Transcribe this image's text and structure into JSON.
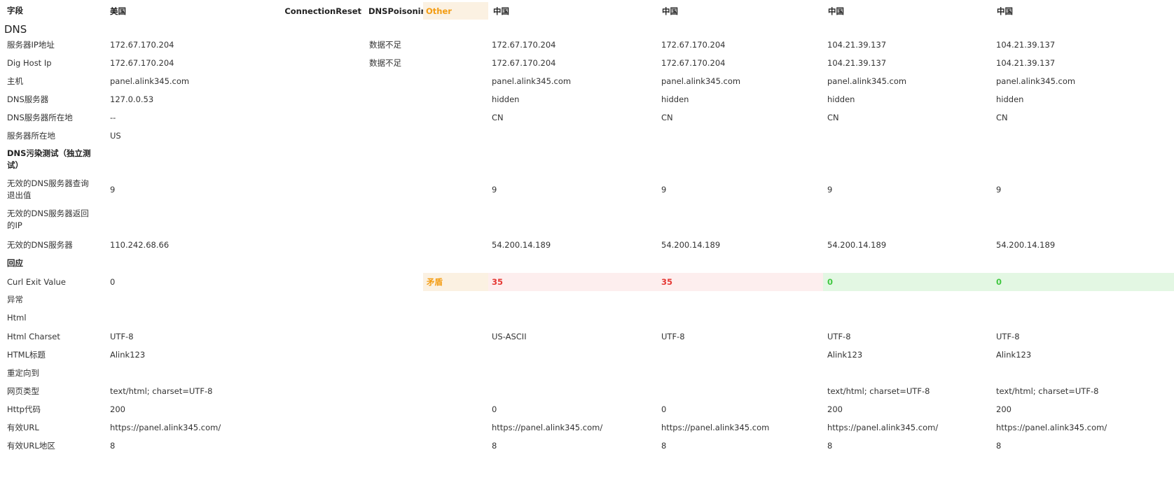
{
  "header": {
    "field": "字段",
    "col1": "美国",
    "col2": "ConnectionReset",
    "col3": "DNSPoisoning",
    "col4": "Other",
    "col5": "中国",
    "col6": "中国",
    "col7": "中国",
    "col8": "中国"
  },
  "section_dns": "DNS",
  "rows": {
    "server_ip": {
      "label": "服务器IP地址",
      "c1": "172.67.170.204",
      "c3": "数据不足",
      "c5": "172.67.170.204",
      "c6": "172.67.170.204",
      "c7": "104.21.39.137",
      "c8": "104.21.39.137"
    },
    "dig_host_ip": {
      "label": "Dig Host Ip",
      "c1": "172.67.170.204",
      "c3": "数据不足",
      "c5": "172.67.170.204",
      "c6": "172.67.170.204",
      "c7": "104.21.39.137",
      "c8": "104.21.39.137"
    },
    "host": {
      "label": "主机",
      "c1": "panel.alink345.com",
      "c5": "panel.alink345.com",
      "c6": "panel.alink345.com",
      "c7": "panel.alink345.com",
      "c8": "panel.alink345.com"
    },
    "dns_server": {
      "label": "DNS服务器",
      "c1": "127.0.0.53",
      "c5": "hidden",
      "c6": "hidden",
      "c7": "hidden",
      "c8": "hidden"
    },
    "dns_server_loc": {
      "label": "DNS服务器所在地",
      "c1": "--",
      "c5": "CN",
      "c6": "CN",
      "c7": "CN",
      "c8": "CN"
    },
    "server_loc": {
      "label": "服务器所在地",
      "c1": "US"
    },
    "dns_poison_test": {
      "label": "DNS污染测试（独立测试）"
    },
    "invalid_dns_exit": {
      "label": "无效的DNS服务器查询退出值",
      "c1": "9",
      "c5": "9",
      "c6": "9",
      "c7": "9",
      "c8": "9"
    },
    "invalid_dns_ip": {
      "label": "无效的DNS服务器返回的IP"
    },
    "invalid_dns_server": {
      "label": "无效的DNS服务器",
      "c1": "110.242.68.66",
      "c5": "54.200.14.189",
      "c6": "54.200.14.189",
      "c7": "54.200.14.189",
      "c8": "54.200.14.189"
    },
    "response": {
      "label": "回应"
    },
    "curl_exit": {
      "label": "Curl Exit Value",
      "c1": "0",
      "c4": "矛盾",
      "c5": "35",
      "c6": "35",
      "c7": "0",
      "c8": "0"
    },
    "exception": {
      "label": "异常"
    },
    "html": {
      "label": "Html"
    },
    "html_charset": {
      "label": "Html Charset",
      "c1": "UTF-8",
      "c5": "US-ASCII",
      "c6": "UTF-8",
      "c7": "UTF-8",
      "c8": "UTF-8"
    },
    "html_title": {
      "label": "HTML标题",
      "c1": "Alink123",
      "c7": "Alink123",
      "c8": "Alink123"
    },
    "redirect": {
      "label": "重定向到"
    },
    "content_type": {
      "label": "网页类型",
      "c1": "text/html; charset=UTF-8",
      "c7": "text/html; charset=UTF-8",
      "c8": "text/html; charset=UTF-8"
    },
    "http_code": {
      "label": "Http代码",
      "c1": "200",
      "c5": "0",
      "c6": "0",
      "c7": "200",
      "c8": "200"
    },
    "valid_url": {
      "label": "有效URL",
      "c1": "https://panel.alink345.com/",
      "c5": "https://panel.alink345.com/",
      "c6": "https://panel.alink345.com",
      "c7": "https://panel.alink345.com/",
      "c8": "https://panel.alink345.com/"
    },
    "valid_url_region": {
      "label": "有效URL地区",
      "c1": "8",
      "c5": "8",
      "c6": "8",
      "c7": "8",
      "c8": "8"
    }
  },
  "colors": {
    "other_orange": "#f39c12",
    "orange_bg": "#fbf1e2",
    "red": "#e53935",
    "red_bg": "#fdeeee",
    "green": "#43c843",
    "green_bg": "#e3f7e3"
  }
}
